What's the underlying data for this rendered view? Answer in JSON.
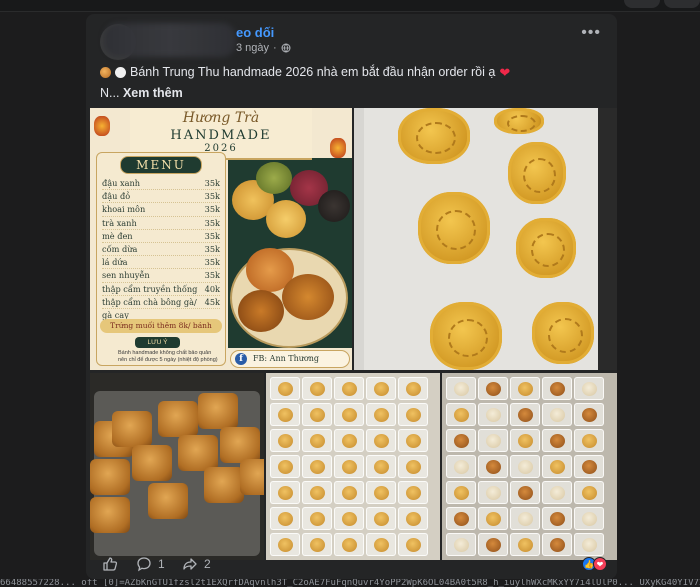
{
  "post": {
    "author_visible": "eo dối",
    "time": "3 ngày",
    "text_line1": "Bánh Trung Thu handmade 2026 nhà em bắt đầu nhận order rồi ạ",
    "truncated_prefix": "N...",
    "see_more": "Xem thêm"
  },
  "menu_image": {
    "script_title": "Hương Trà",
    "handmade": "HANDMADE",
    "year": "2026",
    "menu_title": "MENU",
    "items": [
      {
        "name": "đậu xanh",
        "price": "35k"
      },
      {
        "name": "đậu đỏ",
        "price": "35k"
      },
      {
        "name": "khoai môn",
        "price": "35k"
      },
      {
        "name": "trà xanh",
        "price": "35k"
      },
      {
        "name": "mè đen",
        "price": "35k"
      },
      {
        "name": "cốm dừa",
        "price": "35k"
      },
      {
        "name": "lá dứa",
        "price": "35k"
      },
      {
        "name": "sen nhuyễn",
        "price": "35k"
      },
      {
        "name": "thập cẩm truyền thống",
        "price": "40k"
      },
      {
        "name": "thập cẩm chà bông gà/ gà cay",
        "price": "45k"
      }
    ],
    "extra": "Trứng muối thêm 8k/ bánh",
    "luu_y": "LƯU Ý",
    "note": "Bánh handmade không chất bảo quản nên chỉ để được 5 ngày (nhiệt độ phòng)",
    "fb": "FB: Ann Thương"
  },
  "footer": {
    "comments": "1",
    "shares": "2"
  },
  "colors": {
    "accent": "#4599ff",
    "card": "#242526",
    "text": "#e4e6eb",
    "muted": "#b0b3b8"
  },
  "bottom_text": "66488557228... oft [0]=AZbKnGTU1fzsl2t1EXQrfDAqvnlh3T_C2oAE7FuFqnQuvr4YoPP2WpK6OL04BA0t5R8_h_iuylhWXcMKxYY7i4lUlP0... UXyKG40YIV72"
}
